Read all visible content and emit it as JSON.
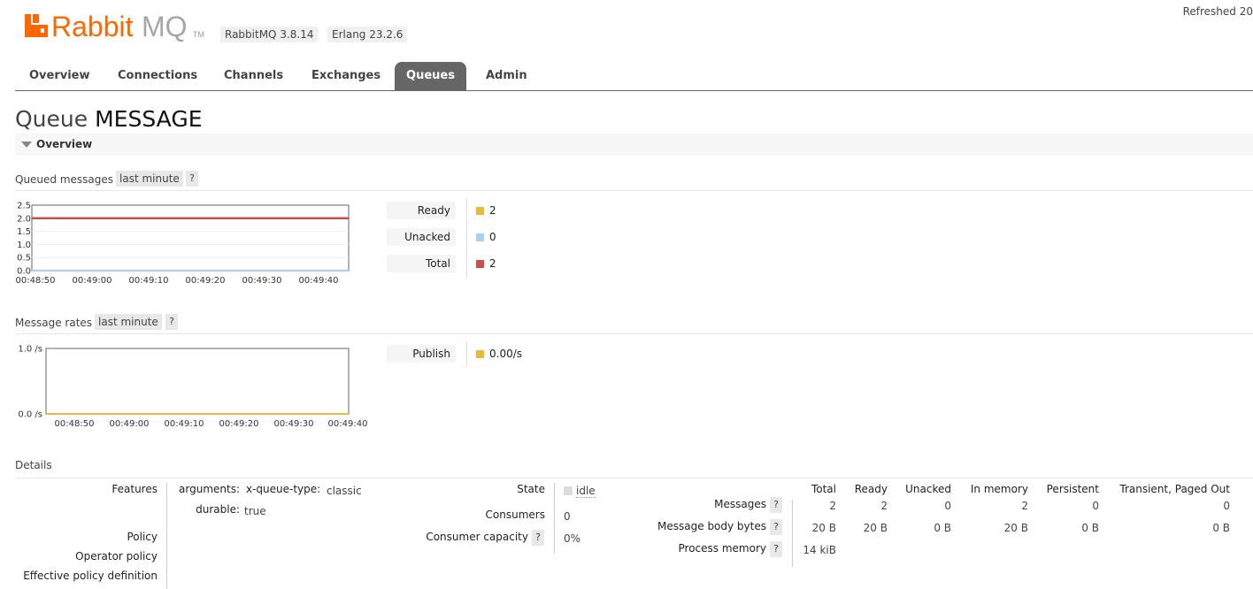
{
  "header": {
    "brand": "RabbitMQ",
    "rabbitmq_version": "RabbitMQ 3.8.14",
    "erlang_version": "Erlang 23.2.6",
    "refreshed": "Refreshed 20"
  },
  "tabs": [
    {
      "label": "Overview",
      "active": false
    },
    {
      "label": "Connections",
      "active": false
    },
    {
      "label": "Channels",
      "active": false
    },
    {
      "label": "Exchanges",
      "active": false
    },
    {
      "label": "Queues",
      "active": true
    },
    {
      "label": "Admin",
      "active": false
    }
  ],
  "page": {
    "title_prefix": "Queue",
    "queue_name": "MESSAGE",
    "overview_label": "Overview"
  },
  "queued_messages": {
    "label": "Queued messages",
    "range": "last minute",
    "help": "?",
    "chart_data": {
      "type": "line",
      "x": [
        "00:48:50",
        "00:49:00",
        "00:49:10",
        "00:49:20",
        "00:49:30",
        "00:49:40"
      ],
      "ylim": [
        0,
        2.5
      ],
      "yticks": [
        "2.5",
        "2.0",
        "1.5",
        "1.0",
        "0.5",
        "0.0"
      ],
      "series": [
        {
          "name": "Ready",
          "values": [
            2,
            2,
            2,
            2,
            2,
            2
          ],
          "color": "#e8b93a"
        },
        {
          "name": "Unacked",
          "values": [
            0,
            0,
            0,
            0,
            0,
            0
          ],
          "color": "#a9d1ed"
        },
        {
          "name": "Total",
          "values": [
            2,
            2,
            2,
            2,
            2,
            2
          ],
          "color": "#c8504a"
        }
      ]
    },
    "legend": [
      {
        "label": "Ready",
        "value": "2",
        "color": "#e8b93a"
      },
      {
        "label": "Unacked",
        "value": "0",
        "color": "#a9d1ed"
      },
      {
        "label": "Total",
        "value": "2",
        "color": "#c8504a"
      }
    ]
  },
  "message_rates": {
    "label": "Message rates",
    "range": "last minute",
    "help": "?",
    "chart_data": {
      "type": "line",
      "x": [
        "00:48:50",
        "00:49:00",
        "00:49:10",
        "00:49:20",
        "00:49:30",
        "00:49:40"
      ],
      "ylim": [
        0,
        1.0
      ],
      "yticks": [
        "1.0 /s",
        "0.0 /s"
      ],
      "series": [
        {
          "name": "Publish",
          "values": [
            0,
            0,
            0,
            0,
            0,
            0
          ],
          "color": "#e8b93a"
        }
      ]
    },
    "legend": [
      {
        "label": "Publish",
        "value": "0.00/s",
        "color": "#e8b93a"
      }
    ]
  },
  "details": {
    "label": "Details",
    "features_label": "Features",
    "arguments_label": "arguments:",
    "x_queue_type_label": "x-queue-type:",
    "x_queue_type_value": "classic",
    "durable_label": "durable:",
    "durable_value": "true",
    "policy_label": "Policy",
    "operator_policy_label": "Operator policy",
    "effective_policy_label": "Effective policy definition",
    "state_label": "State",
    "state_value": "idle",
    "consumers_label": "Consumers",
    "consumers_value": "0",
    "consumer_capacity_label": "Consumer capacity",
    "consumer_capacity_help": "?",
    "consumer_capacity_value": "0%"
  },
  "messages_table": {
    "columns": [
      "Total",
      "Ready",
      "Unacked",
      "In memory",
      "Persistent",
      "Transient, Paged Out"
    ],
    "rows": [
      {
        "label": "Messages",
        "help": "?",
        "cells": [
          "2",
          "2",
          "0",
          "2",
          "0",
          "0"
        ]
      },
      {
        "label": "Message body bytes",
        "help": "?",
        "cells": [
          "20 B",
          "20 B",
          "0 B",
          "20 B",
          "0 B",
          "0 B"
        ]
      },
      {
        "label": "Process memory",
        "help": "?",
        "cells": [
          "14 kiB",
          "",
          "",
          "",
          "",
          ""
        ]
      }
    ]
  }
}
